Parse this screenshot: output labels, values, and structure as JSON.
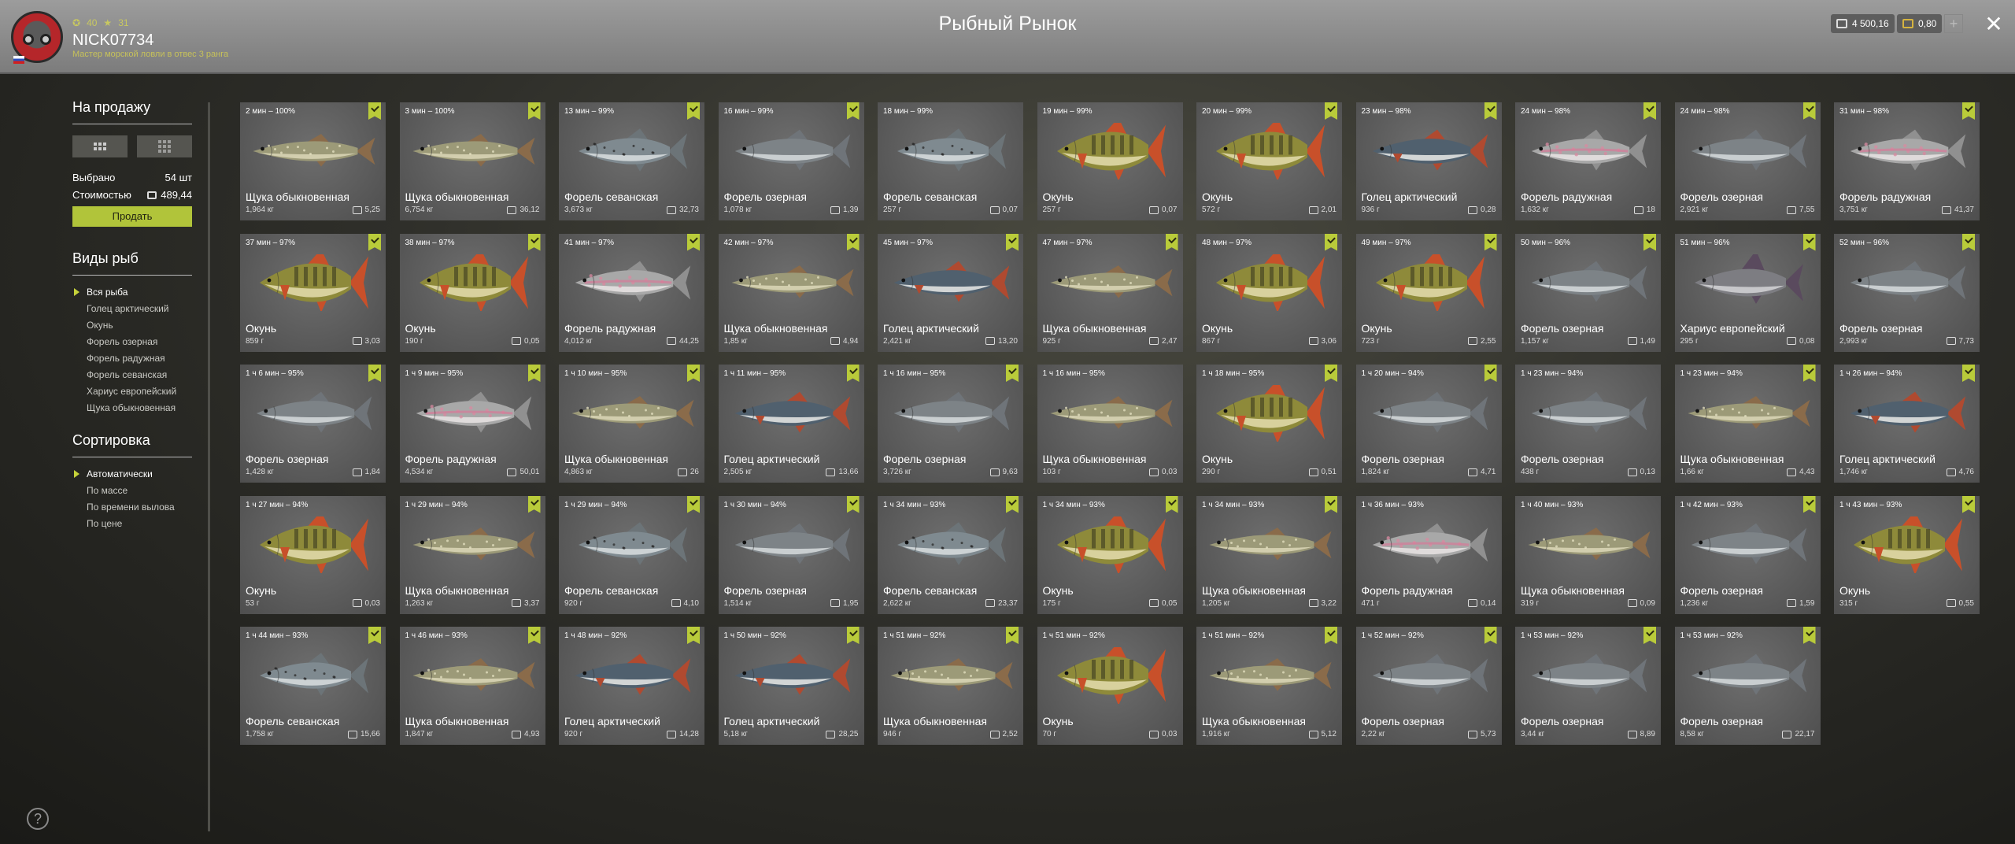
{
  "header": {
    "title": "Рыбный Рынок",
    "username": "NICK07734",
    "stat_a": "40",
    "stat_b": "31",
    "rank_text": "Мастер морской ловли в отвес 3 ранга",
    "silver": "4 500,16",
    "gold": "0,80",
    "plus": "+",
    "close": "✕"
  },
  "sidebar": {
    "sale_title": "На продажу",
    "selected_label": "Выбрано",
    "selected_value": "54 шт",
    "cost_label": "Стоимостью",
    "cost_value": "489,44",
    "sell_button": "Продать",
    "species_title": "Виды рыб",
    "species": [
      "Вся рыба",
      "Голец арктический",
      "Окунь",
      "Форель озерная",
      "Форель радужная",
      "Форель севанская",
      "Хариус европейский",
      "Щука обыкновенная"
    ],
    "sort_title": "Сортировка",
    "sort": [
      "Автоматически",
      "По массе",
      "По времени вылова",
      "По цене"
    ],
    "help": "?"
  },
  "colors": {
    "accent": "#b9cb3a",
    "card_bg": "#5a5a5a"
  },
  "fish": [
    {
      "time": "2 мин – 100%",
      "name": "Щука обыкновенная",
      "weight": "1,964 кг",
      "price": "5,25",
      "type": "pike",
      "checked": true
    },
    {
      "time": "3 мин – 100%",
      "name": "Щука обыкновенная",
      "weight": "6,754 кг",
      "price": "36,12",
      "type": "pike",
      "checked": true
    },
    {
      "time": "13 мин – 99%",
      "name": "Форель севанская",
      "weight": "3,673 кг",
      "price": "32,73",
      "type": "sevan",
      "checked": true
    },
    {
      "time": "16 мин – 99%",
      "name": "Форель озерная",
      "weight": "1,078 кг",
      "price": "1,39",
      "type": "lake",
      "checked": true
    },
    {
      "time": "18 мин – 99%",
      "name": "Форель севанская",
      "weight": "257 г",
      "price": "0,07",
      "type": "sevan",
      "checked": false
    },
    {
      "time": "19 мин – 99%",
      "name": "Окунь",
      "weight": "257 г",
      "price": "0,07",
      "type": "perch",
      "checked": false
    },
    {
      "time": "20 мин – 99%",
      "name": "Окунь",
      "weight": "572 г",
      "price": "2,01",
      "type": "perch",
      "checked": true
    },
    {
      "time": "23 мин – 98%",
      "name": "Голец арктический",
      "weight": "936 г",
      "price": "0,28",
      "type": "charr",
      "checked": true
    },
    {
      "time": "24 мин – 98%",
      "name": "Форель радужная",
      "weight": "1,632 кг",
      "price": "18",
      "type": "rainbow",
      "checked": true
    },
    {
      "time": "24 мин – 98%",
      "name": "Форель озерная",
      "weight": "2,921 кг",
      "price": "7,55",
      "type": "lake",
      "checked": true
    },
    {
      "time": "31 мин – 98%",
      "name": "Форель радужная",
      "weight": "3,751 кг",
      "price": "41,37",
      "type": "rainbow",
      "checked": true
    },
    {
      "time": "37 мин – 97%",
      "name": "Окунь",
      "weight": "859 г",
      "price": "3,03",
      "type": "perch",
      "checked": true
    },
    {
      "time": "38 мин – 97%",
      "name": "Окунь",
      "weight": "190 г",
      "price": "0,05",
      "type": "perch",
      "checked": true
    },
    {
      "time": "41 мин – 97%",
      "name": "Форель радужная",
      "weight": "4,012 кг",
      "price": "44,25",
      "type": "rainbow",
      "checked": true
    },
    {
      "time": "42 мин – 97%",
      "name": "Щука обыкновенная",
      "weight": "1,85 кг",
      "price": "4,94",
      "type": "pike",
      "checked": true
    },
    {
      "time": "45 мин – 97%",
      "name": "Голец арктический",
      "weight": "2,421 кг",
      "price": "13,20",
      "type": "charr",
      "checked": true
    },
    {
      "time": "47 мин – 97%",
      "name": "Щука обыкновенная",
      "weight": "925 г",
      "price": "2,47",
      "type": "pike",
      "checked": true
    },
    {
      "time": "48 мин – 97%",
      "name": "Окунь",
      "weight": "867 г",
      "price": "3,06",
      "type": "perch",
      "checked": true
    },
    {
      "time": "49 мин – 97%",
      "name": "Окунь",
      "weight": "723 г",
      "price": "2,55",
      "type": "perch",
      "checked": true
    },
    {
      "time": "50 мин – 96%",
      "name": "Форель озерная",
      "weight": "1,157 кг",
      "price": "1,49",
      "type": "lake",
      "checked": true
    },
    {
      "time": "51 мин – 96%",
      "name": "Хариус европейский",
      "weight": "295 г",
      "price": "0,08",
      "type": "grayling",
      "checked": true
    },
    {
      "time": "52 мин – 96%",
      "name": "Форель озерная",
      "weight": "2,993 кг",
      "price": "7,73",
      "type": "lake",
      "checked": true
    },
    {
      "time": "1 ч 6 мин – 95%",
      "name": "Форель озерная",
      "weight": "1,428 кг",
      "price": "1,84",
      "type": "lake",
      "checked": true
    },
    {
      "time": "1 ч 9 мин – 95%",
      "name": "Форель радужная",
      "weight": "4,534 кг",
      "price": "50,01",
      "type": "rainbow",
      "checked": true
    },
    {
      "time": "1 ч 10 мин – 95%",
      "name": "Щука обыкновенная",
      "weight": "4,863 кг",
      "price": "26",
      "type": "pike",
      "checked": true
    },
    {
      "time": "1 ч 11 мин – 95%",
      "name": "Голец арктический",
      "weight": "2,505 кг",
      "price": "13,66",
      "type": "charr",
      "checked": true
    },
    {
      "time": "1 ч 16 мин – 95%",
      "name": "Форель озерная",
      "weight": "3,726 кг",
      "price": "9,63",
      "type": "lake",
      "checked": true
    },
    {
      "time": "1 ч 16 мин – 95%",
      "name": "Щука обыкновенная",
      "weight": "103 г",
      "price": "0,03",
      "type": "pike",
      "checked": false
    },
    {
      "time": "1 ч 18 мин – 95%",
      "name": "Окунь",
      "weight": "290 г",
      "price": "0,51",
      "type": "perch",
      "checked": true
    },
    {
      "time": "1 ч 20 мин – 94%",
      "name": "Форель озерная",
      "weight": "1,824 кг",
      "price": "4,71",
      "type": "lake",
      "checked": true
    },
    {
      "time": "1 ч 23 мин – 94%",
      "name": "Форель озерная",
      "weight": "438 г",
      "price": "0,13",
      "type": "lake",
      "checked": false
    },
    {
      "time": "1 ч 23 мин – 94%",
      "name": "Щука обыкновенная",
      "weight": "1,66 кг",
      "price": "4,43",
      "type": "pike",
      "checked": true
    },
    {
      "time": "1 ч 26 мин – 94%",
      "name": "Голец арктический",
      "weight": "1,746 кг",
      "price": "4,76",
      "type": "charr",
      "checked": true
    },
    {
      "time": "1 ч 27 мин – 94%",
      "name": "Окунь",
      "weight": "53 г",
      "price": "0,03",
      "type": "perch",
      "checked": false
    },
    {
      "time": "1 ч 29 мин – 94%",
      "name": "Щука обыкновенная",
      "weight": "1,263 кг",
      "price": "3,37",
      "type": "pike",
      "checked": true
    },
    {
      "time": "1 ч 29 мин – 94%",
      "name": "Форель севанская",
      "weight": "920 г",
      "price": "4,10",
      "type": "sevan",
      "checked": true
    },
    {
      "time": "1 ч 30 мин – 94%",
      "name": "Форель озерная",
      "weight": "1,514 кг",
      "price": "1,95",
      "type": "lake",
      "checked": true
    },
    {
      "time": "1 ч 34 мин – 93%",
      "name": "Форель севанская",
      "weight": "2,622 кг",
      "price": "23,37",
      "type": "sevan",
      "checked": true
    },
    {
      "time": "1 ч 34 мин – 93%",
      "name": "Окунь",
      "weight": "175 г",
      "price": "0,05",
      "type": "perch",
      "checked": true
    },
    {
      "time": "1 ч 34 мин – 93%",
      "name": "Щука обыкновенная",
      "weight": "1,205 кг",
      "price": "3,22",
      "type": "pike",
      "checked": true
    },
    {
      "time": "1 ч 36 мин – 93%",
      "name": "Форель радужная",
      "weight": "471 г",
      "price": "0,14",
      "type": "rainbow",
      "checked": false
    },
    {
      "time": "1 ч 40 мин – 93%",
      "name": "Щука обыкновенная",
      "weight": "319 г",
      "price": "0,09",
      "type": "pike",
      "checked": false
    },
    {
      "time": "1 ч 42 мин – 93%",
      "name": "Форель озерная",
      "weight": "1,236 кг",
      "price": "1,59",
      "type": "lake",
      "checked": true
    },
    {
      "time": "1 ч 43 мин – 93%",
      "name": "Окунь",
      "weight": "315 г",
      "price": "0,55",
      "type": "perch",
      "checked": true
    },
    {
      "time": "1 ч 44 мин – 93%",
      "name": "Форель севанская",
      "weight": "1,758 кг",
      "price": "15,66",
      "type": "sevan",
      "checked": true
    },
    {
      "time": "1 ч 46 мин – 93%",
      "name": "Щука обыкновенная",
      "weight": "1,847 кг",
      "price": "4,93",
      "type": "pike",
      "checked": true
    },
    {
      "time": "1 ч 48 мин – 92%",
      "name": "Голец арктический",
      "weight": "920 г",
      "price": "14,28",
      "type": "charr",
      "checked": true
    },
    {
      "time": "1 ч 50 мин – 92%",
      "name": "Голец арктический",
      "weight": "5,18 кг",
      "price": "28,25",
      "type": "charr",
      "checked": true
    },
    {
      "time": "1 ч 51 мин – 92%",
      "name": "Щука обыкновенная",
      "weight": "946 г",
      "price": "2,52",
      "type": "pike",
      "checked": true
    },
    {
      "time": "1 ч 51 мин – 92%",
      "name": "Окунь",
      "weight": "70 г",
      "price": "0,03",
      "type": "perch",
      "checked": false
    },
    {
      "time": "1 ч 51 мин – 92%",
      "name": "Щука обыкновенная",
      "weight": "1,916 кг",
      "price": "5,12",
      "type": "pike",
      "checked": true
    },
    {
      "time": "1 ч 52 мин – 92%",
      "name": "Форель озерная",
      "weight": "2,22 кг",
      "price": "5,73",
      "type": "lake",
      "checked": true
    },
    {
      "time": "1 ч 53 мин – 92%",
      "name": "Форель озерная",
      "weight": "3,44 кг",
      "price": "8,89",
      "type": "lake",
      "checked": true
    },
    {
      "time": "1 ч 53 мин – 92%",
      "name": "Форель озерная",
      "weight": "8,58 кг",
      "price": "22,17",
      "type": "lake",
      "checked": true
    }
  ]
}
